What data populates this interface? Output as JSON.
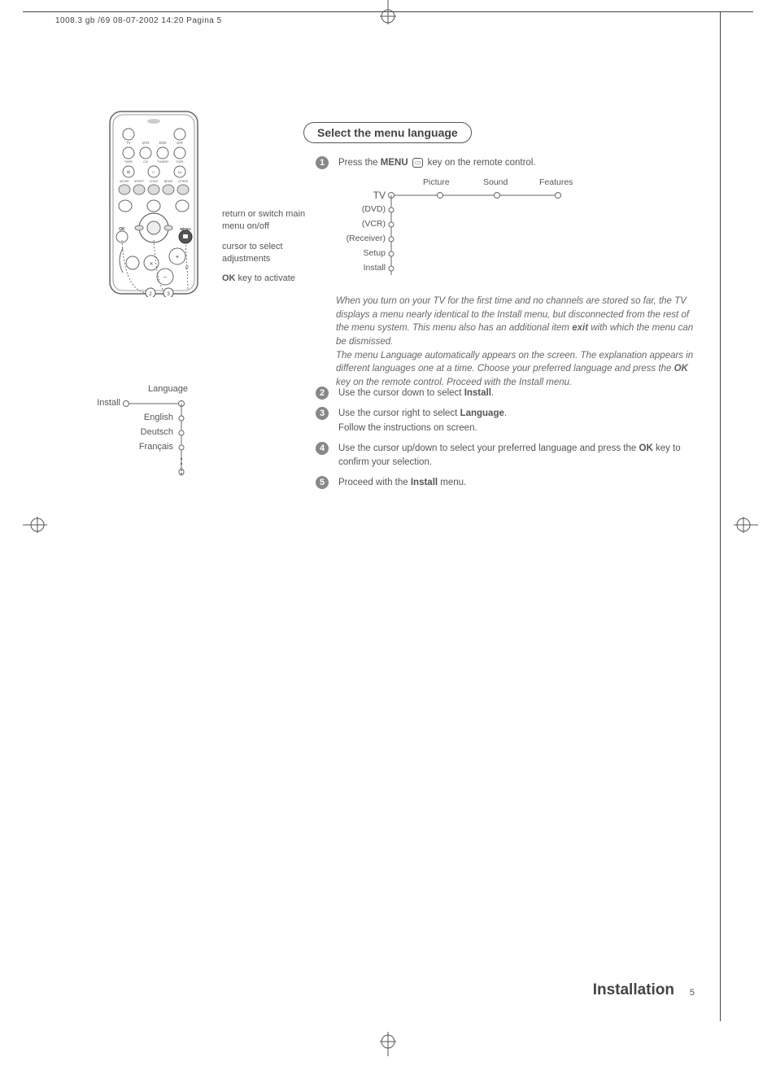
{
  "header": {
    "crop_text": "1008.3 gb /69  08-07-2002  14:20  Pagina 5"
  },
  "remote_labels": {
    "line1": "return or switch main menu on/off",
    "line2": "cursor to select adjustments",
    "line3_bold": "OK",
    "line3_rest": " key to activate"
  },
  "section_title": "Select the menu language",
  "step1": {
    "num": "1",
    "pre": "Press the ",
    "bold": "MENU",
    "post": " key on the remote control."
  },
  "tv_menu": {
    "cols": [
      "Picture",
      "Sound",
      "Features"
    ],
    "rows": [
      "TV",
      "(DVD)",
      "(VCR)",
      "(Receiver)",
      "Setup",
      "Install"
    ]
  },
  "note": {
    "p1a": "When you turn on your TV for the first time and no channels are stored so far, the TV displays a menu nearly identical to the Install menu, but disconnected from the rest of the menu system. This menu also has an additional item ",
    "p1bold": "exit",
    "p1b": " with which the menu can be dismissed.",
    "p2a": "The menu Language automatically appears on the screen. The explanation appears in different languages one at a time. Choose your preferred language and press the ",
    "p2bold": "OK",
    "p2b": " key on the remote control. Proceed with the Install menu."
  },
  "step2": {
    "num": "2",
    "pre": "Use the cursor down to select ",
    "bold": "Install",
    "post": "."
  },
  "step3": {
    "num": "3",
    "pre": "Use the cursor right to select ",
    "bold": "Language",
    "post": ".",
    "line2": "Follow the instructions on screen."
  },
  "step4": {
    "num": "4",
    "pre": "Use the cursor up/down to select your preferred language and press the ",
    "bold": "OK",
    "post": " key to confirm your selection."
  },
  "step5": {
    "num": "5",
    "pre": "Proceed with the ",
    "bold": "Install",
    "post": " menu."
  },
  "lang_diagram": {
    "header": "Language",
    "root": "Install",
    "items": [
      "English",
      "Deutsch",
      "Français"
    ]
  },
  "footer": {
    "title": "Installation",
    "page": "5"
  }
}
